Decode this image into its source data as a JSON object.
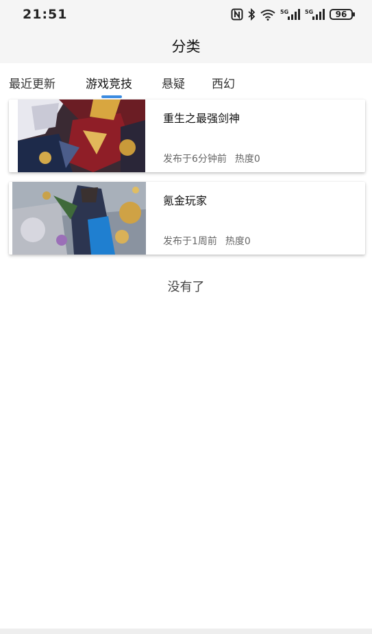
{
  "status_bar": {
    "time": "21:51",
    "battery": "96",
    "network_1": "5G",
    "network_2": "5G",
    "icons": [
      "nfc-icon",
      "bluetooth-icon",
      "wifi-icon",
      "signal-icon",
      "signal-icon",
      "battery-icon"
    ]
  },
  "header": {
    "title": "分类"
  },
  "tabs": [
    {
      "label": "最近更新",
      "active": false
    },
    {
      "label": "游戏竞技",
      "active": true
    },
    {
      "label": "悬疑",
      "active": false
    },
    {
      "label": "西幻",
      "active": false
    }
  ],
  "accent_color": "#3b8be0",
  "books": [
    {
      "title": "重生之最强剑神",
      "published": "发布于6分钟前",
      "heat": "热度0"
    },
    {
      "title": "氪金玩家",
      "published": "发布于1周前",
      "heat": "热度0"
    }
  ],
  "list_end_text": "没有了"
}
